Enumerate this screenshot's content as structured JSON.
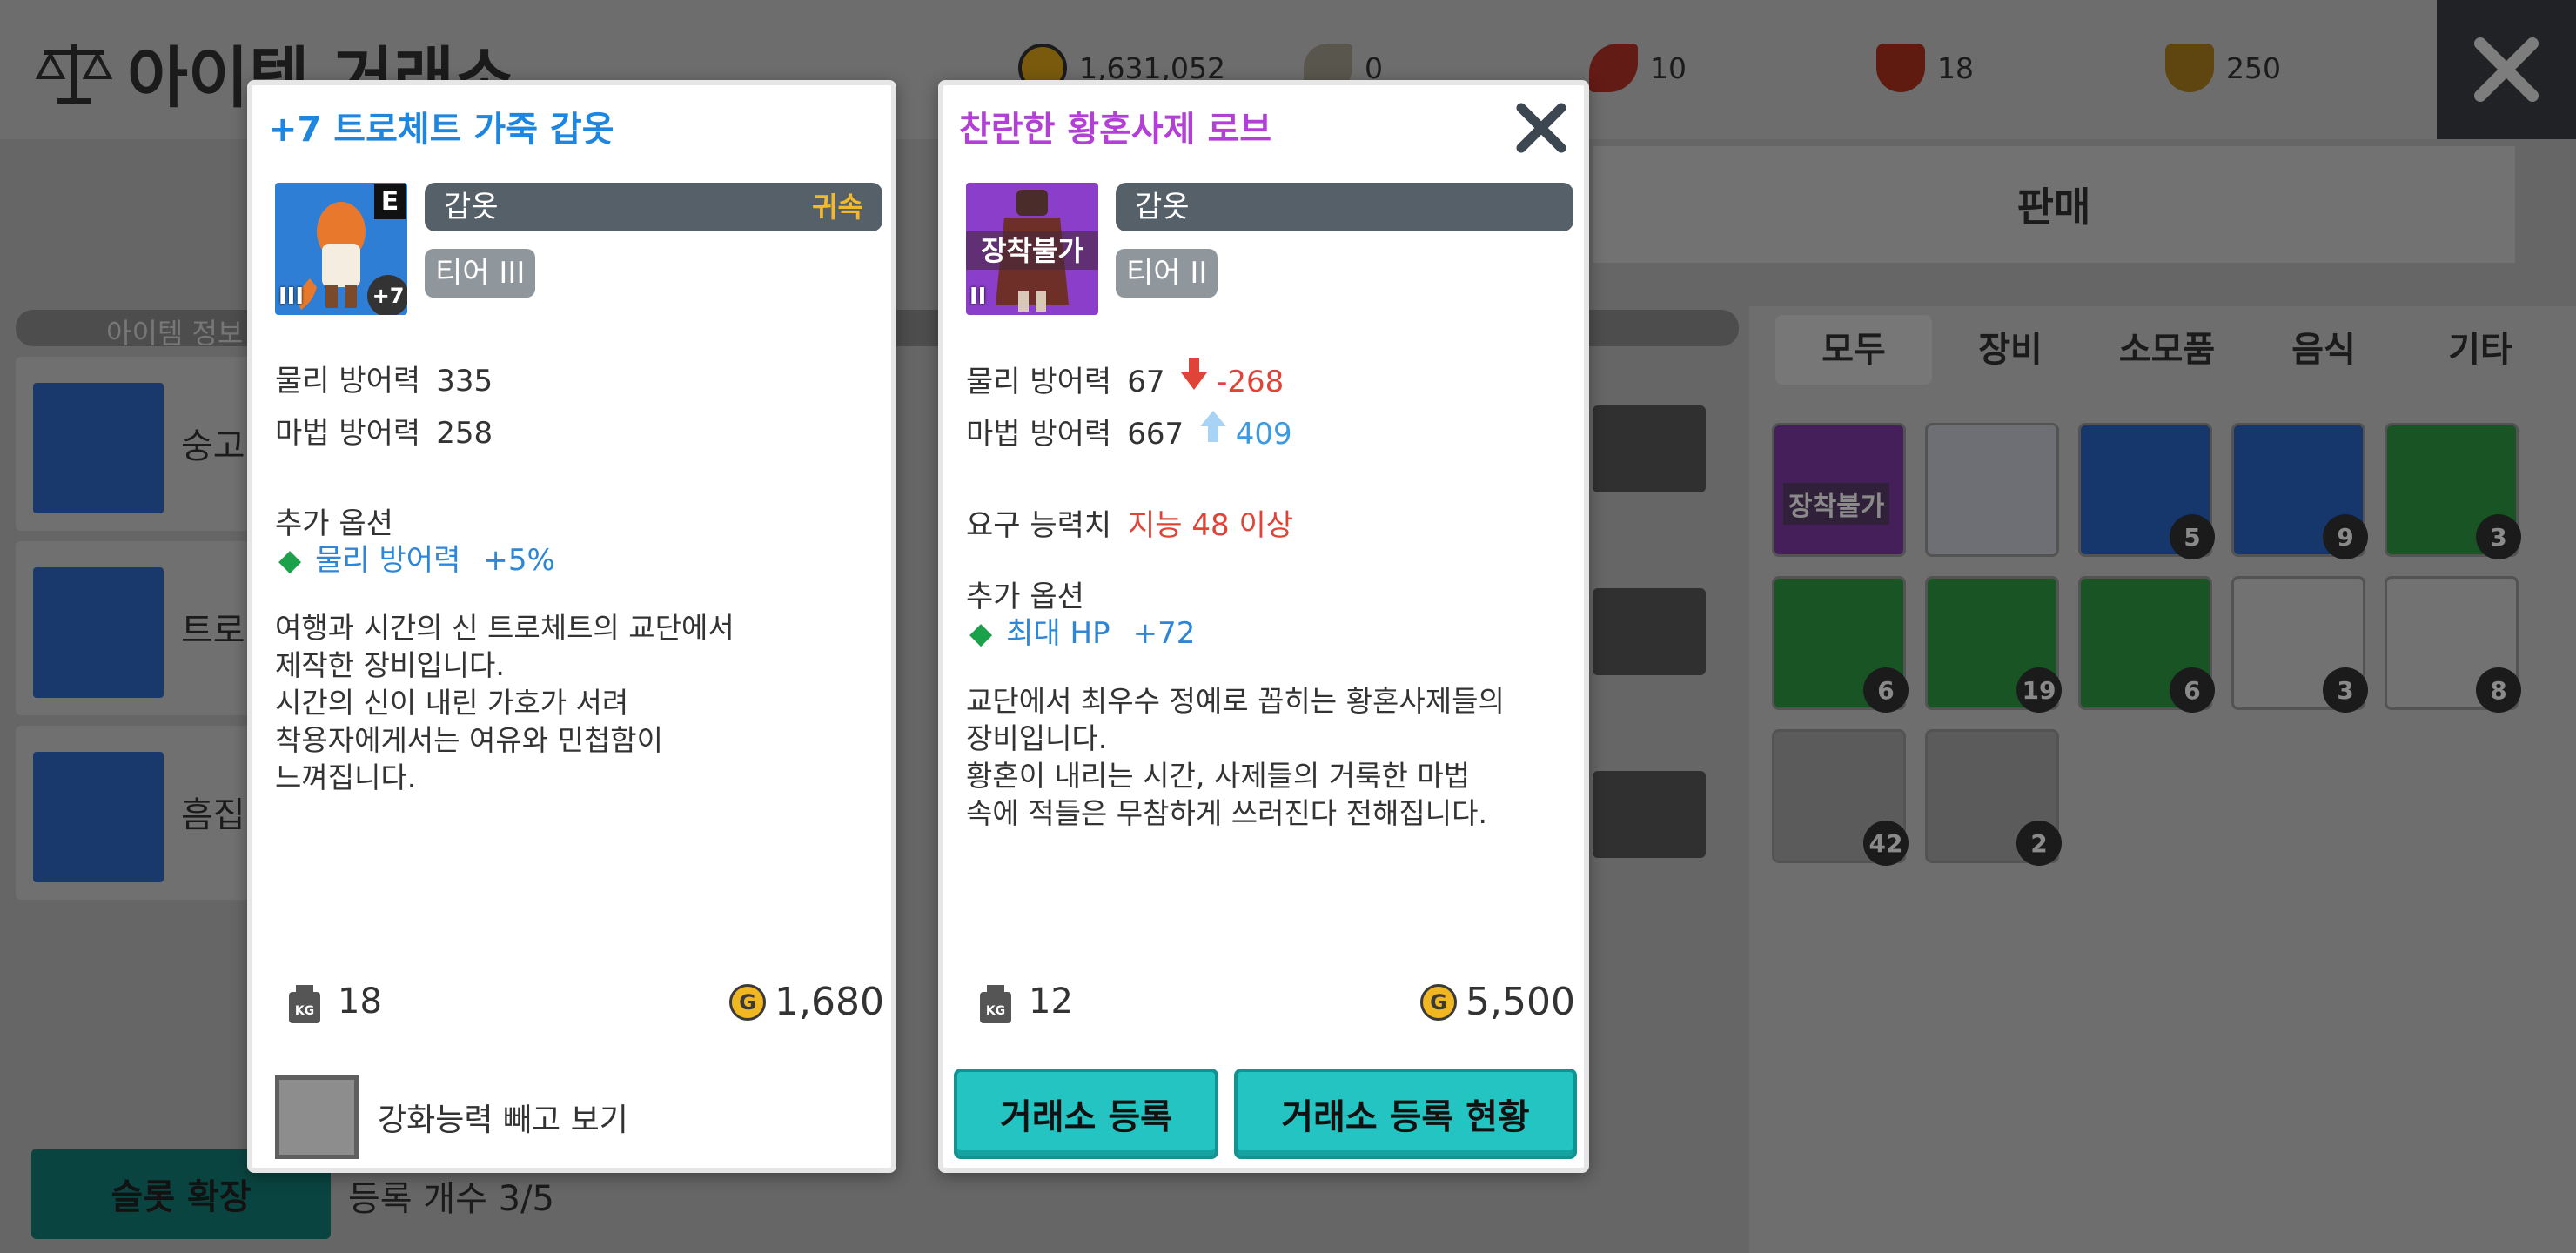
{
  "background": {
    "title": "아이템 거래소",
    "resources": [
      {
        "icon": "gold-coin-icon",
        "value": "1,631,052"
      },
      {
        "icon": "seed-icon",
        "value": "0"
      },
      {
        "icon": "red-leaf-icon",
        "value": "10"
      },
      {
        "icon": "crown-shield-icon",
        "value": "18"
      },
      {
        "icon": "medal-icon",
        "value": "250"
      }
    ],
    "sell_tab": "판매",
    "categories": [
      "모두",
      "장비",
      "소모품",
      "음식",
      "기타"
    ],
    "selected_category": "모두",
    "list_header": "아이템 정보",
    "list_items": [
      "숭고",
      "트로",
      "흠집"
    ],
    "inventory": [
      {
        "bg": "#7e3aa6",
        "label": "장착불가",
        "count": ""
      },
      {
        "bg": "#c9cdd8",
        "label": "",
        "count": ""
      },
      {
        "bg": "#2a67c7",
        "label": "",
        "count": "5"
      },
      {
        "bg": "#2a67c7",
        "label": "",
        "count": "9"
      },
      {
        "bg": "#2e9b43",
        "label": "",
        "count": "3"
      },
      {
        "bg": "#2e9b43",
        "label": "",
        "count": "6"
      },
      {
        "bg": "#2e9b43",
        "label": "",
        "count": "19"
      },
      {
        "bg": "#2e9b43",
        "label": "",
        "count": "6"
      },
      {
        "bg": "#d3d3d3",
        "label": "",
        "count": "3"
      },
      {
        "bg": "#d3d3d3",
        "label": "",
        "count": "8"
      },
      {
        "bg": "#a9a9a9",
        "label": "",
        "count": "42"
      },
      {
        "bg": "#a9a9a9",
        "label": "",
        "count": "2"
      }
    ],
    "slot_expand": "슬롯 확장",
    "slot_count": "등록 개수 3/5"
  },
  "left_popup": {
    "title": "+7 트로체트 가죽 갑옷",
    "title_color": "#1f86e0",
    "icon_bg": "#2f7ed6",
    "equipped_badge": "E",
    "enhance_badge": "+7",
    "tier_badge": "III",
    "type": "갑옷",
    "binding": "귀속",
    "tier": "티어 III",
    "stats": [
      {
        "label": "물리 방어력",
        "value": "335"
      },
      {
        "label": "마법 방어력",
        "value": "258"
      }
    ],
    "extra_label": "추가 옵션",
    "options": [
      {
        "name": "물리 방어력",
        "value": "+5%"
      }
    ],
    "description": "여행과 시간의 신 트로체트의 교단에서\n제작한 장비입니다.\n시간의 신이 내린 가호가 서려\n착용자에게서는 여유와 민첩함이\n느껴집니다.",
    "weight": "18",
    "price": "1,680",
    "coin_symbol": "G",
    "checkbox_label": "강화능력 빼고 보기"
  },
  "right_popup": {
    "title": "찬란한 황혼사제 로브",
    "title_color": "#b23fd6",
    "icon_bg": "#8a3ec9",
    "overlay_label": "장착불가",
    "tier_badge": "II",
    "type": "갑옷",
    "tier": "티어 II",
    "stats": [
      {
        "label": "물리 방어력",
        "value": "67",
        "diff": "-268"
      },
      {
        "label": "마법 방어력",
        "value": "667",
        "diff": "409"
      }
    ],
    "requirement_label": "요구 능력치",
    "requirement_value": "지능 48 이상",
    "extra_label": "추가 옵션",
    "options": [
      {
        "name": "최대 HP",
        "value": "+72"
      }
    ],
    "description": "교단에서 최우수 정예로 꼽히는 황혼사제들의\n장비입니다.\n황혼이 내리는 시간, 사제들의 거룩한 마법\n속에 적들은 무참하게 쓰러진다 전해집니다.",
    "weight": "12",
    "price": "5,500",
    "coin_symbol": "G",
    "register_button": "거래소 등록",
    "status_button": "거래소 등록 현황"
  }
}
